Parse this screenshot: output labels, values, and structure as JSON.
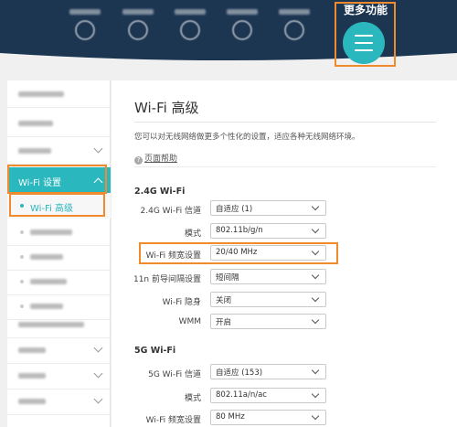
{
  "header": {
    "more_functions_label": "更多功能"
  },
  "main": {
    "title": "Wi-Fi 高级",
    "description": "您可以对无线网络做更多个性化的设置，适应各种无线网络环境。",
    "help_link": "页面帮助",
    "help_icon": "?"
  },
  "sidebar": {
    "wifi_settings_label": "Wi-Fi 设置",
    "wifi_advanced_label": "Wi-Fi 高级"
  },
  "section_24": {
    "title": "2.4G Wi-Fi",
    "rows": [
      {
        "label": "2.4G Wi-Fi 信道",
        "value": "自适应 (1)"
      },
      {
        "label": "模式",
        "value": "802.11b/g/n"
      },
      {
        "label": "Wi-Fi 频宽设置",
        "value": "20/40 MHz"
      },
      {
        "label": "11n 前导间隔设置",
        "value": "短间隔"
      },
      {
        "label": "Wi-Fi 隐身",
        "value": "关闭"
      },
      {
        "label": "WMM",
        "value": "开启"
      }
    ]
  },
  "section_5": {
    "title": "5G Wi-Fi",
    "rows": [
      {
        "label": "5G Wi-Fi 信道",
        "value": "自适应 (153)"
      },
      {
        "label": "模式",
        "value": "802.11a/n/ac"
      },
      {
        "label": "Wi-Fi 频宽设置",
        "value": "80 MHz"
      }
    ]
  },
  "colors": {
    "accent": "#2bb7be",
    "highlight": "#f08a2c",
    "nav": "#1c3551"
  }
}
